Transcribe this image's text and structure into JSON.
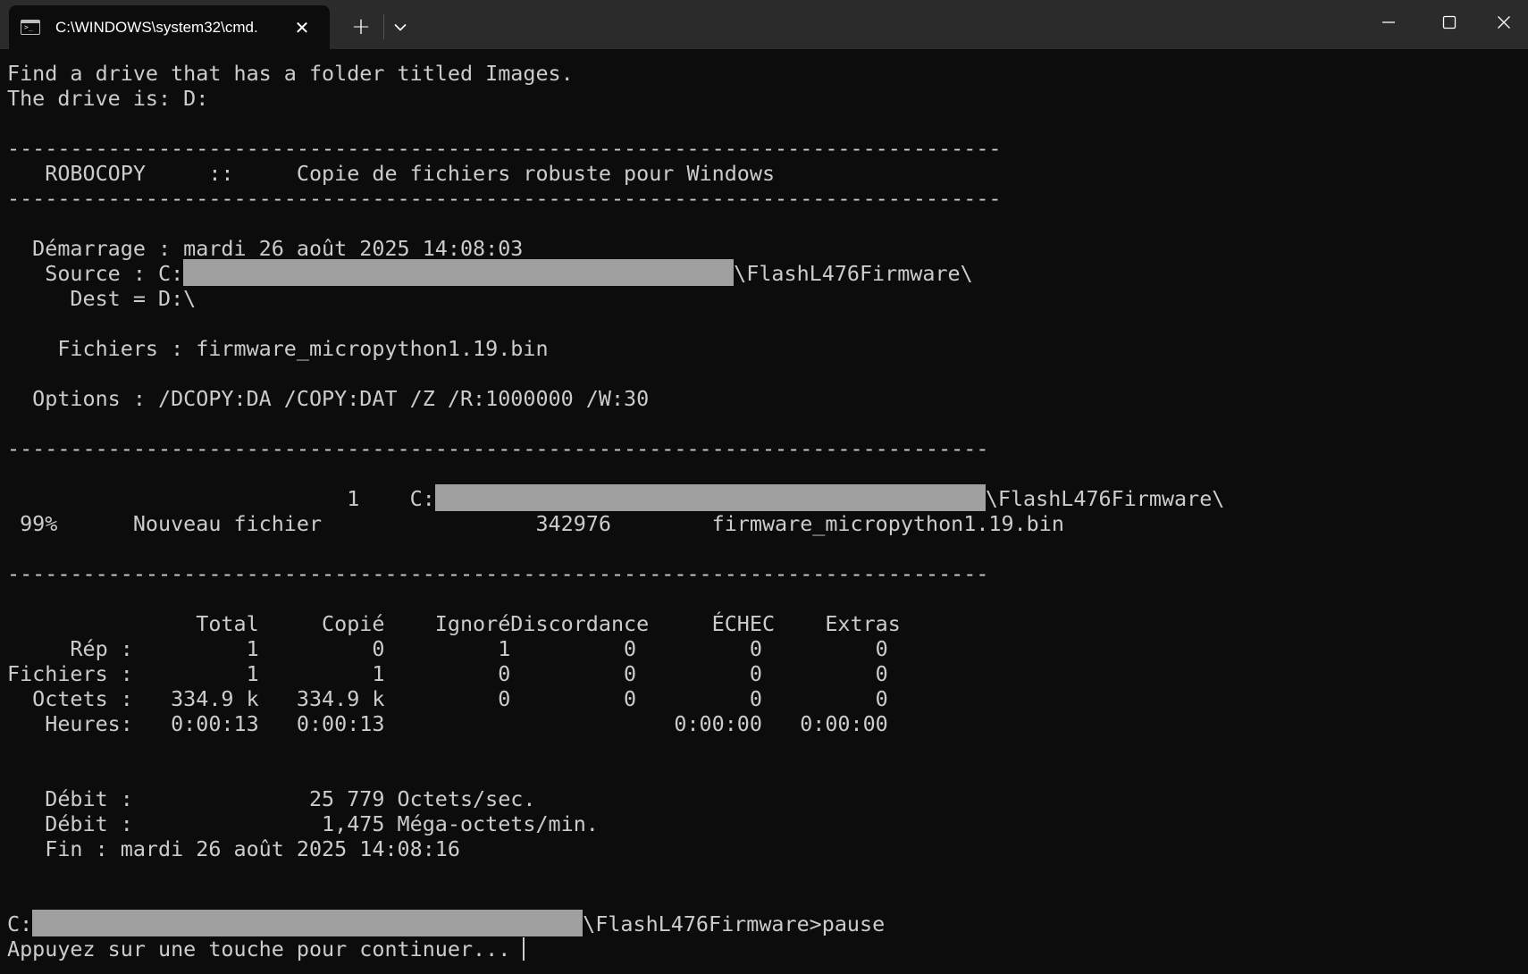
{
  "window": {
    "tab_title": "C:\\WINDOWS\\system32\\cmd.",
    "tab_icon": "command-prompt-icon",
    "tab_icon_glyph": ">_",
    "new_tab_label": "+",
    "close_tab_label": "✕"
  },
  "terminal": {
    "lines": [
      "Find a drive that has a folder titled Images.",
      "The drive is: D:",
      "",
      "-------------------------------------------------------------------------------",
      "   ROBOCOPY     ::     Copie de fichiers robuste pour Windows",
      "-------------------------------------------------------------------------------",
      "",
      "  Démarrage : mardi 26 août 2025 14:08:03",
      "   Source : C:",
      "     Dest = D:\\",
      "",
      "    Fichiers : firmware_micropython1.19.bin",
      "",
      "  Options : /DCOPY:DA /COPY:DAT /Z /R:1000000 /W:30",
      "",
      "------------------------------------------------------------------------------",
      "",
      "                           1    C:",
      " 99%      Nouveau fichier                 342976        firmware_micropython1.19.bin",
      "",
      "------------------------------------------------------------------------------",
      "",
      "               Total     Copié    IgnoréDiscordance     ÉCHEC    Extras",
      "     Rép :         1         0         1         0         0         0",
      "Fichiers :         1         1         0         0         0         0",
      "  Octets :   334.9 k   334.9 k         0         0         0         0",
      "   Heures:   0:00:13   0:00:13                       0:00:00   0:00:00",
      "",
      "",
      "   Débit :              25 779 Octets/sec.",
      "   Débit :               1,475 Méga-octets/min.",
      "   Fin : mardi 26 août 2025 14:08:16",
      "",
      "",
      "C:",
      "Appuyez sur une touche pour continuer... "
    ],
    "source_path_suffix": "\\FlashL476Firmware\\",
    "job_path_suffix": "\\FlashL476Firmware\\",
    "prompt_suffix": "\\FlashL476Firmware>pause"
  }
}
